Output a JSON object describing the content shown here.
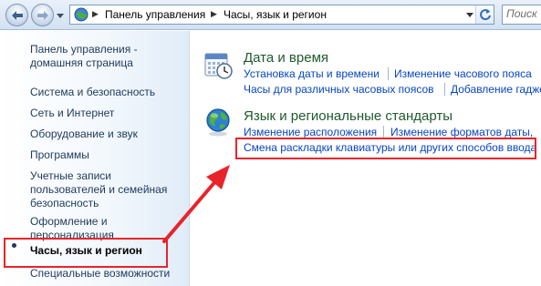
{
  "address_bar": {
    "crumbs": [
      "Панель управления",
      "Часы, язык и регион"
    ],
    "search_placeholder": "Поиск"
  },
  "sidebar": {
    "items": [
      {
        "label": "Панель управления - домашняя страница",
        "active": false
      },
      {
        "label": "Система и безопасность",
        "active": false
      },
      {
        "label": "Сеть и Интернет",
        "active": false
      },
      {
        "label": "Оборудование и звук",
        "active": false
      },
      {
        "label": "Программы",
        "active": false
      },
      {
        "label": "Учетные записи пользователей и семейная безопасность",
        "active": false
      },
      {
        "label": "Оформление и персонализация",
        "active": false
      },
      {
        "label": "Часы, язык и регион",
        "active": true
      },
      {
        "label": "Специальные возможности",
        "active": false
      }
    ]
  },
  "categories": [
    {
      "title": "Дата и время",
      "icon": "clock-calendar-icon",
      "links": [
        "Установка даты и времени",
        "Изменение часового пояса",
        "Часы для различных часовых поясов",
        "Добавление гадже"
      ]
    },
    {
      "title": "Язык и региональные стандарты",
      "icon": "globe-icon",
      "links": [
        "Изменение расположения",
        "Изменение форматов даты,",
        "Смена раскладки клавиатуры или других способов ввода"
      ]
    }
  ],
  "colors": {
    "highlight": "#e8242b",
    "link": "#0645c6",
    "category_title": "#1e5a2d",
    "sidebar_text": "#1e395b"
  }
}
